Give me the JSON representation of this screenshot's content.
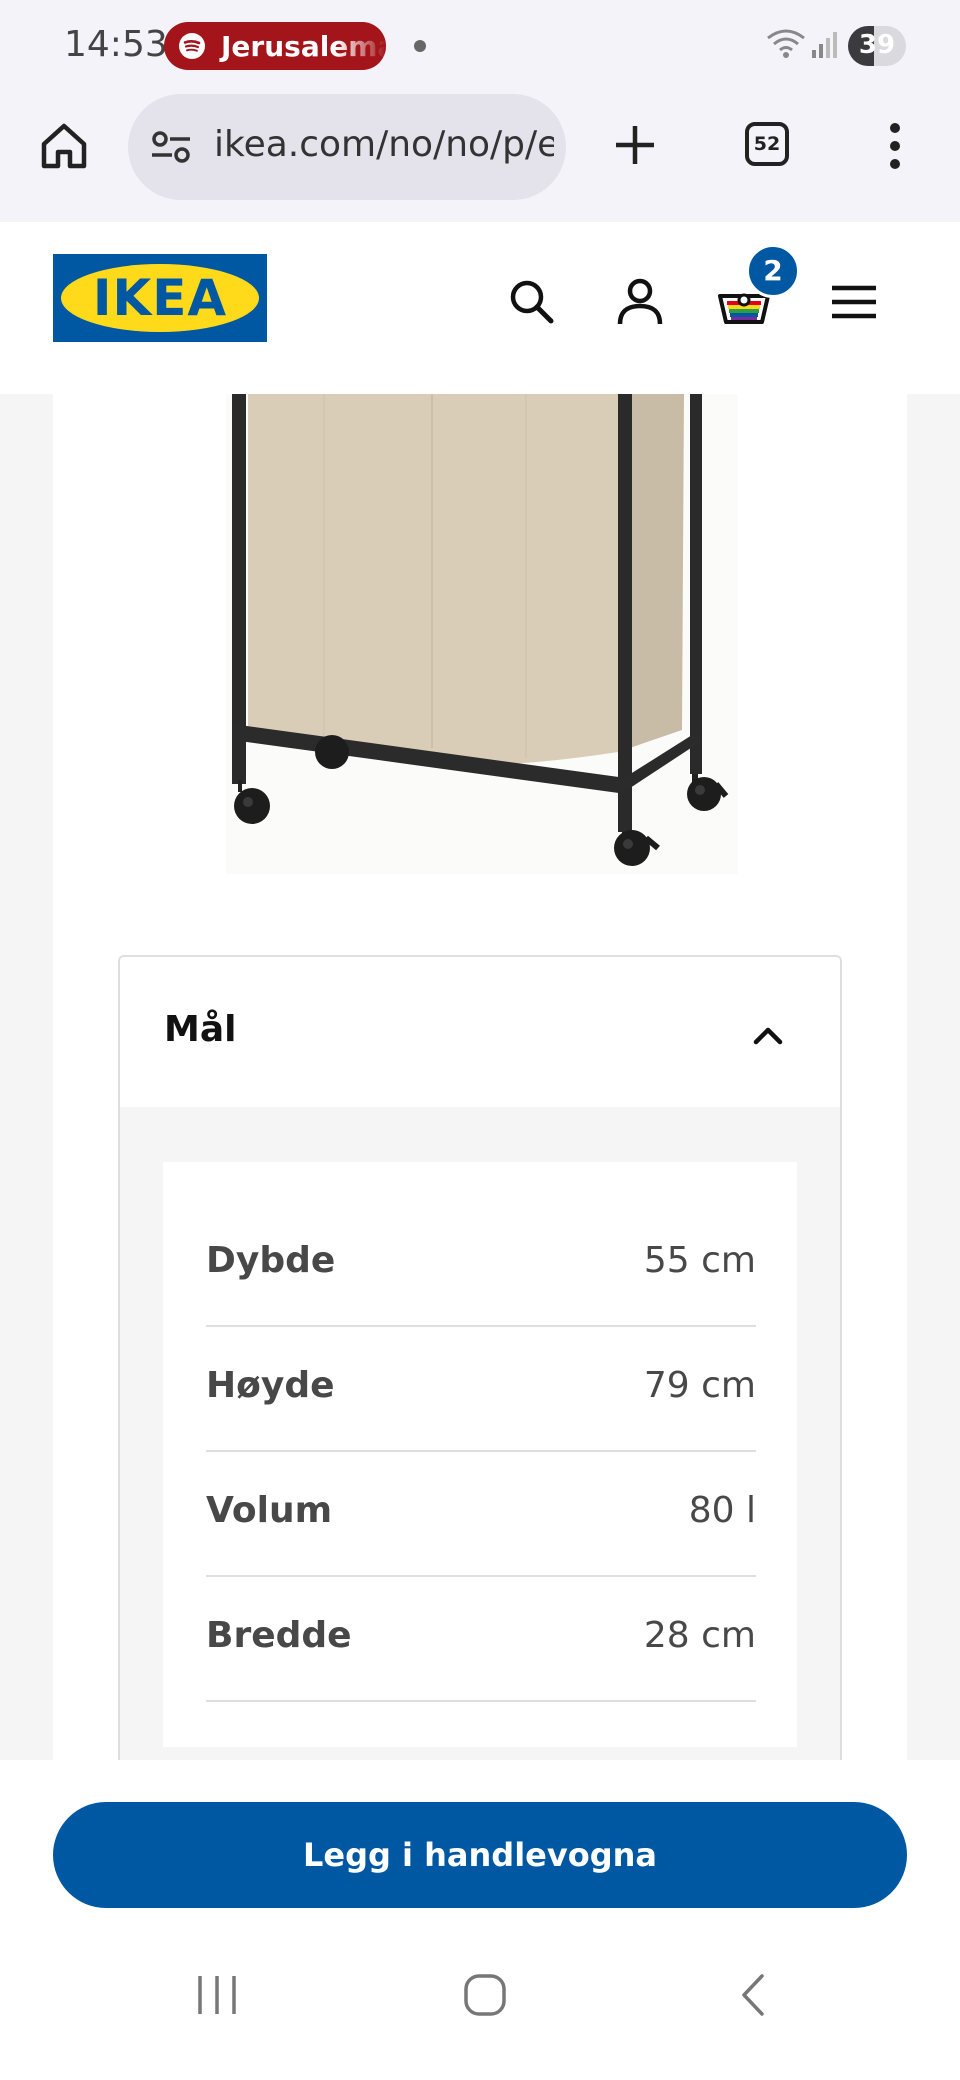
{
  "status_bar": {
    "time": "14:53",
    "media_pill": "Jerusalema",
    "battery": "39",
    "icons": [
      "spotify-icon",
      "notification-dot-icon",
      "wifi-icon",
      "signal-icon",
      "battery-icon"
    ]
  },
  "browser": {
    "url": "ikea.com/no/no/p/e",
    "tab_count": "52",
    "icons": [
      "home-icon",
      "site-settings-icon",
      "new-tab-icon",
      "tab-switcher-icon",
      "more-menu-icon"
    ]
  },
  "header": {
    "logo_text": "IKEA",
    "cart_count": "2",
    "icons": [
      "search-icon",
      "account-icon",
      "cart-icon",
      "hamburger-menu-icon"
    ]
  },
  "product": {
    "image_alt": "laundry-hamper-on-wheels"
  },
  "dimensions": {
    "title": "Mål",
    "expanded": true,
    "rows": [
      {
        "label": "Dybde",
        "value": "55 cm"
      },
      {
        "label": "Høyde",
        "value": "79 cm"
      },
      {
        "label": "Volum",
        "value": "80 l"
      },
      {
        "label": "Bredde",
        "value": "28 cm"
      }
    ]
  },
  "buy": {
    "label": "Legg i handlevogna"
  },
  "system_nav": [
    "recents-icon",
    "home-nav-icon",
    "back-icon"
  ],
  "colors": {
    "ikea_blue": "#0058a3",
    "ikea_yellow": "#ffda1a",
    "media_pill": "#a3151a",
    "page_grey": "#f5f5f5",
    "divider": "#dfdfdf"
  }
}
